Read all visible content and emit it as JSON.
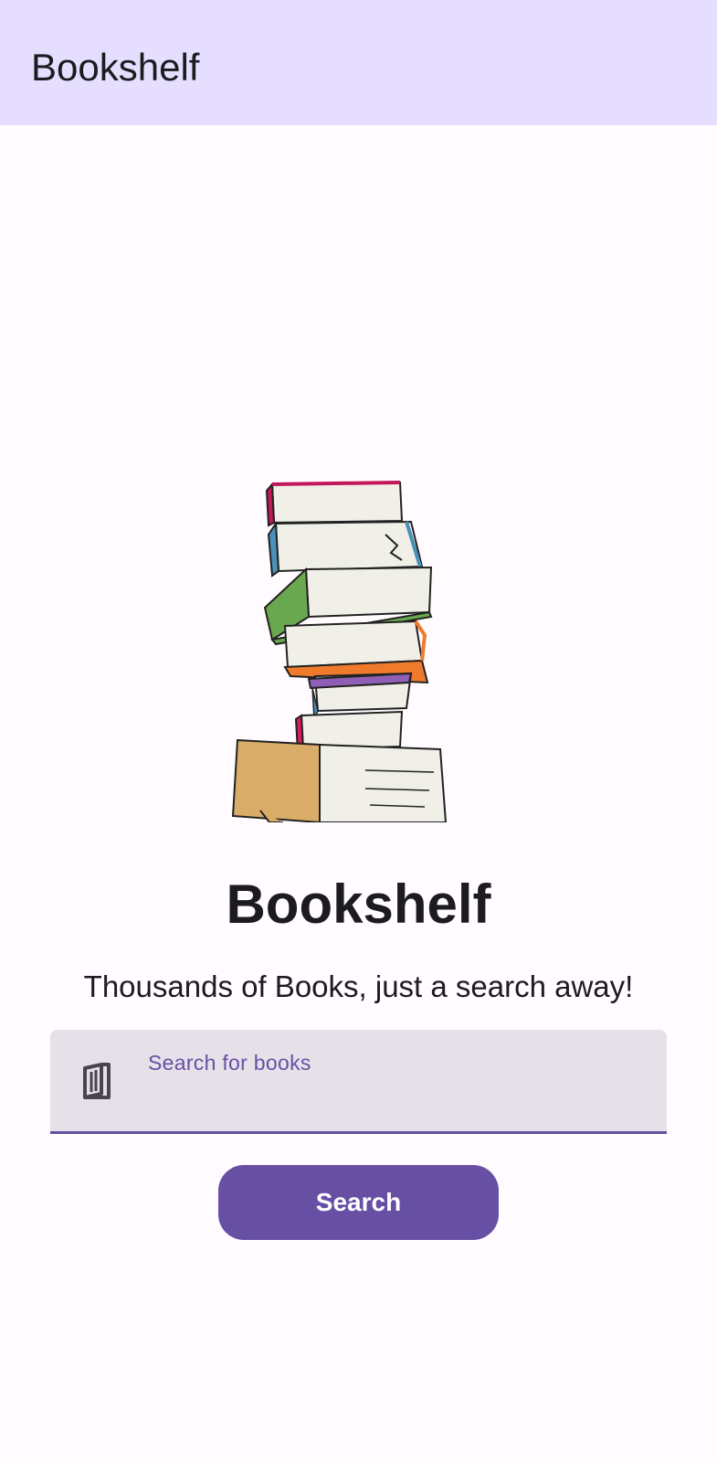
{
  "app_bar": {
    "title": "Bookshelf"
  },
  "hero": {
    "illustration": "stack-of-books-illustration",
    "title": "Bookshelf",
    "subtitle": "Thousands of Books, just a search away!"
  },
  "search": {
    "icon": "book-icon",
    "label": "Search for books",
    "value": "",
    "button_label": "Search"
  },
  "colors": {
    "app_bar_background": "#e6deff",
    "page_background": "#fffbfe",
    "primary": "#6750a4",
    "field_background": "#e6e0e9",
    "text": "#1c1b1f"
  }
}
